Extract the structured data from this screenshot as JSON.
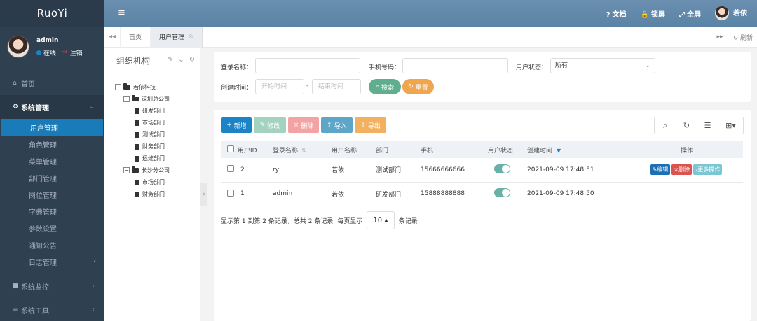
{
  "app": {
    "logo": "RuoYi"
  },
  "user": {
    "name": "admin",
    "status": "在线",
    "logout": "注销",
    "header_name": "若依"
  },
  "header": {
    "docs": "文档",
    "lock": "锁屏",
    "fullscreen": "全屏"
  },
  "sidebar": {
    "home": "首页",
    "system": "系统管理",
    "sub_items": [
      "用户管理",
      "角色管理",
      "菜单管理",
      "部门管理",
      "岗位管理",
      "字典管理",
      "参数设置",
      "通知公告",
      "日志管理"
    ],
    "monitor": "系统监控",
    "tools": "系统工具"
  },
  "tabs": {
    "home": "首页",
    "active": "用户管理",
    "refresh": "刷新"
  },
  "tree": {
    "title": "组织机构",
    "root": "若依科技",
    "branch1": "深圳总公司",
    "branch1_children": [
      "研发部门",
      "市场部门",
      "测试部门",
      "财务部门",
      "运维部门"
    ],
    "branch2": "长沙分公司",
    "branch2_children": [
      "市场部门",
      "财务部门"
    ]
  },
  "search": {
    "login_name_label": "登录名称：",
    "phone_label": "手机号码：",
    "status_label": "用户状态：",
    "status_value": "所有",
    "created_label": "创建时间：",
    "start_placeholder": "开始时间",
    "end_placeholder": "结束时间",
    "dash": "-",
    "search_btn": "搜索",
    "reset_btn": "重置"
  },
  "toolbar": {
    "add": "新增",
    "edit": "修改",
    "delete": "删除",
    "import": "导入",
    "export": "导出"
  },
  "table": {
    "headers": [
      "用户ID",
      "登录名称",
      "用户名称",
      "部门",
      "手机",
      "用户状态",
      "创建时间",
      "操作"
    ],
    "rows": [
      {
        "id": "2",
        "login": "ry",
        "name": "若依",
        "dept": "测试部门",
        "phone": "15666666666",
        "created": "2021-09-09 17:48:51"
      },
      {
        "id": "1",
        "login": "admin",
        "name": "若依",
        "dept": "研发部门",
        "phone": "15888888888",
        "created": "2021-09-09 17:48:50"
      }
    ],
    "row_actions": {
      "edit": "编辑",
      "delete": "删除",
      "more": "更多操作"
    }
  },
  "pager": {
    "summary": "显示第 1 到第 2 条记录，总共 2 条记录",
    "per_page_label": "每页显示",
    "page_size": "10",
    "records_suffix": "条记录"
  },
  "colors": {
    "sidebar": "#2f4050",
    "header": "#5e86a8",
    "active": "#1a7bb9",
    "primary": "#1c84c6"
  }
}
